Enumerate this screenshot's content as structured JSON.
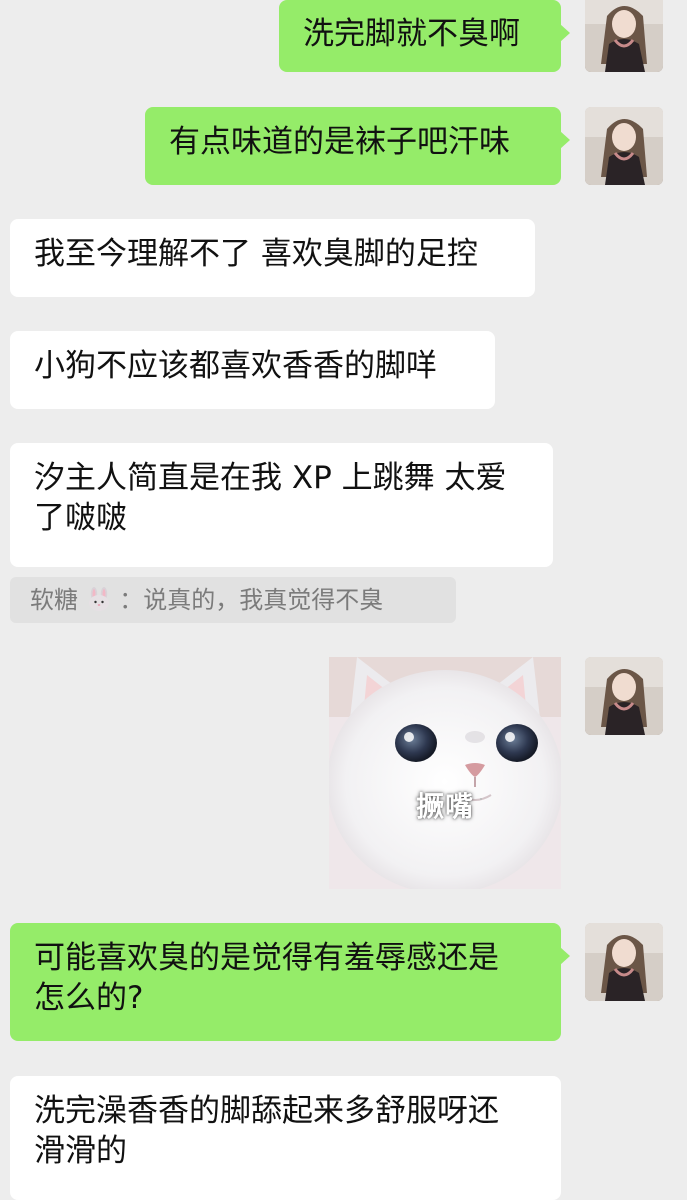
{
  "messages": [
    {
      "side": "me",
      "text": "洗完脚就不臭啊"
    },
    {
      "side": "me",
      "text": "有点味道的是袜子吧汗味"
    },
    {
      "side": "other",
      "text": "我至今理解不了 喜欢臭脚的足控"
    },
    {
      "side": "other",
      "text": "小狗不应该都喜欢香香的脚咩"
    },
    {
      "side": "other",
      "text": "汐主人简直是在我 XP 上跳舞 太爱\n了啵啵"
    },
    {
      "side": "me",
      "text": "可能喜欢臭的是觉得有羞辱感还是\n怎么的?"
    },
    {
      "side": "other",
      "text": "洗完澡香香的脚舔起来多舒服呀还\n滑滑的"
    }
  ],
  "quote": {
    "sender": "软糖",
    "emoji": "rabbit-face-icon",
    "separator": "：",
    "text": "说真的，我真觉得不臭"
  },
  "sticker": {
    "caption": "撅嘴",
    "subject": "white-kitten-sticker"
  },
  "colors": {
    "background": "#ededed",
    "my_bubble": "#95ec69",
    "other_bubble": "#ffffff",
    "quote_bg": "#e1e1e1",
    "quote_text": "#7b7b7b"
  }
}
